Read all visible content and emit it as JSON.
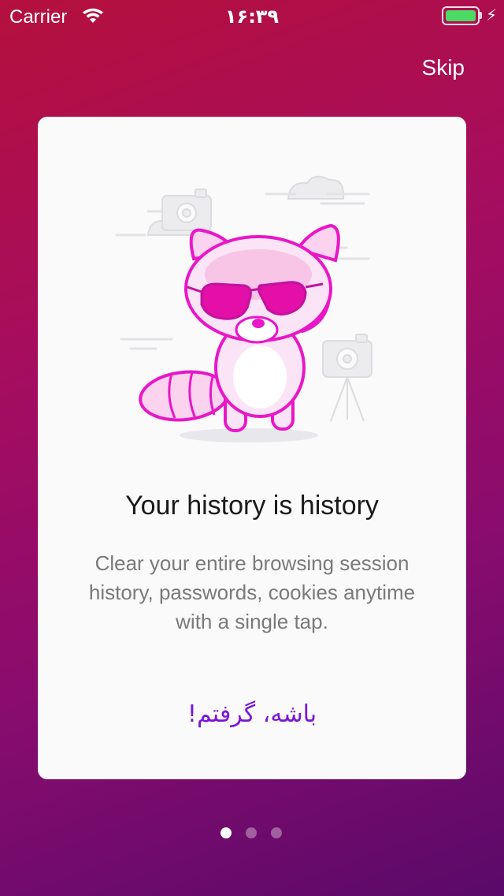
{
  "status_bar": {
    "carrier": "Carrier",
    "time": "۱۶:۳۹",
    "battery_level": 1.0,
    "icons": [
      "wifi-icon",
      "battery-icon",
      "charging-bolt-icon"
    ]
  },
  "header": {
    "skip_label": "Skip"
  },
  "onboarding": {
    "title": "Your history is history",
    "description": "Clear your entire browsing session history, passwords, cookies anytime with a single tap.",
    "cta_label": "باشه، گرفتم!"
  },
  "pager": {
    "total_pages": 3,
    "current_page": 1
  },
  "colors": {
    "background_start": "#b5103d",
    "background_end": "#5a0a6a",
    "card": "#fafafa",
    "accent": "#7b16d8",
    "character": "#e817c8"
  }
}
